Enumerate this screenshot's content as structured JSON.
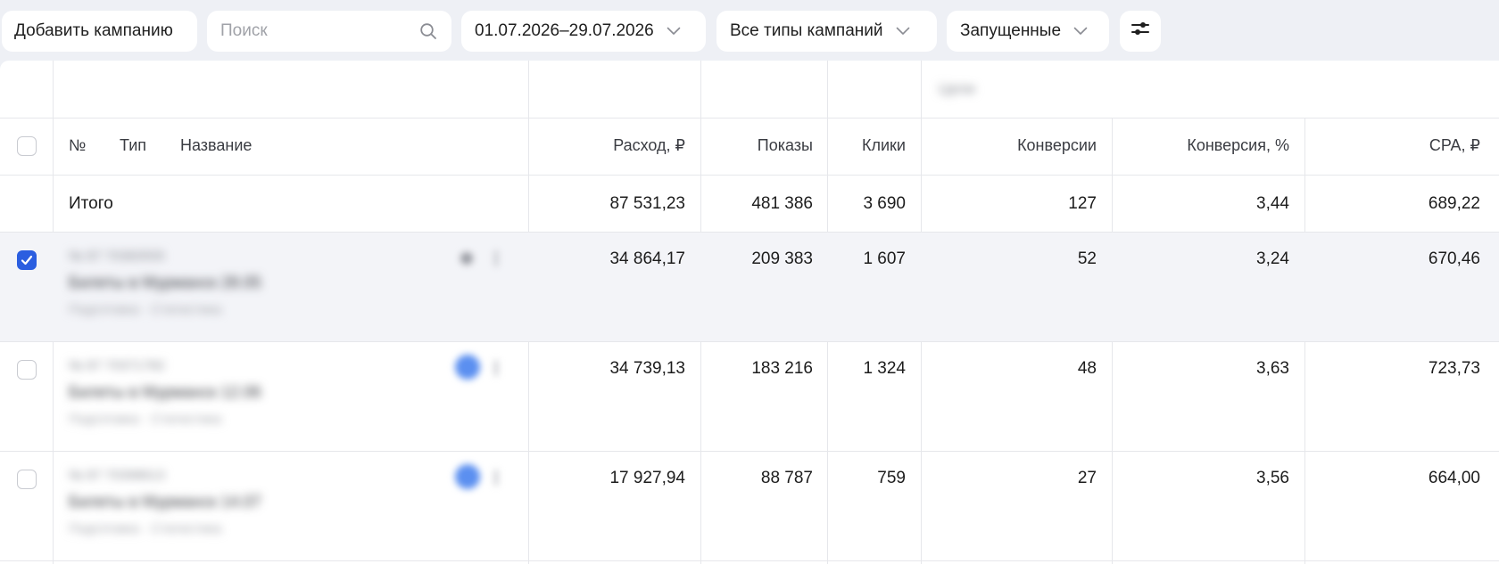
{
  "toolbar": {
    "add_campaign_label": "Добавить кампанию",
    "search_placeholder": "Поиск",
    "date_range": "01.07.2026–29.07.2026",
    "campaign_types": "Все типы кампаний",
    "status_filter": "Запущенные"
  },
  "table": {
    "group_header_label": "Цели",
    "columns": {
      "number": "№",
      "type": "Тип",
      "name": "Название",
      "spend": "Расход, ₽",
      "impressions": "Показы",
      "clicks": "Клики",
      "conversions": "Конверсии",
      "conversion_rate": "Конверсия, %",
      "cpa": "CPA, ₽"
    },
    "totals": {
      "label": "Итого",
      "spend": "87 531,23",
      "impressions": "481 386",
      "clicks": "3 690",
      "conversions": "127",
      "conversion_rate": "3,44",
      "cpa": "689,22"
    },
    "rows": [
      {
        "checked": true,
        "campaign_id": "№ 87 70383555",
        "campaign_name": "Билеты в Мурманск 28.05",
        "campaign_meta": "Подготовка · Статистика",
        "spend": "34 864,17",
        "impressions": "209 383",
        "clicks": "1 607",
        "conversions": "52",
        "conversion_rate": "3,24",
        "cpa": "670,46"
      },
      {
        "checked": false,
        "campaign_id": "№ 87 70371782",
        "campaign_name": "Билеты в Мурманск 12.06",
        "campaign_meta": "Подготовка · Статистика",
        "spend": "34 739,13",
        "impressions": "183 216",
        "clicks": "1 324",
        "conversions": "48",
        "conversion_rate": "3,63",
        "cpa": "723,73"
      },
      {
        "checked": false,
        "campaign_id": "№ 87 70398613",
        "campaign_name": "Билеты в Мурманск 14.07",
        "campaign_meta": "Подготовка · Статистика",
        "spend": "17 927,94",
        "impressions": "88 787",
        "clicks": "759",
        "conversions": "27",
        "conversion_rate": "3,56",
        "cpa": "664,00"
      }
    ]
  },
  "colors": {
    "accent": "#2b5ee0",
    "page_bg": "#eef0f5",
    "selected_row_bg": "#f3f4f8",
    "type_icon_blue": "#5b8ff0"
  },
  "icons": {
    "search": "search-icon",
    "chevron": "chevron-down-icon",
    "settings": "filter-settings-icon",
    "checkmark": "checkmark-icon"
  }
}
